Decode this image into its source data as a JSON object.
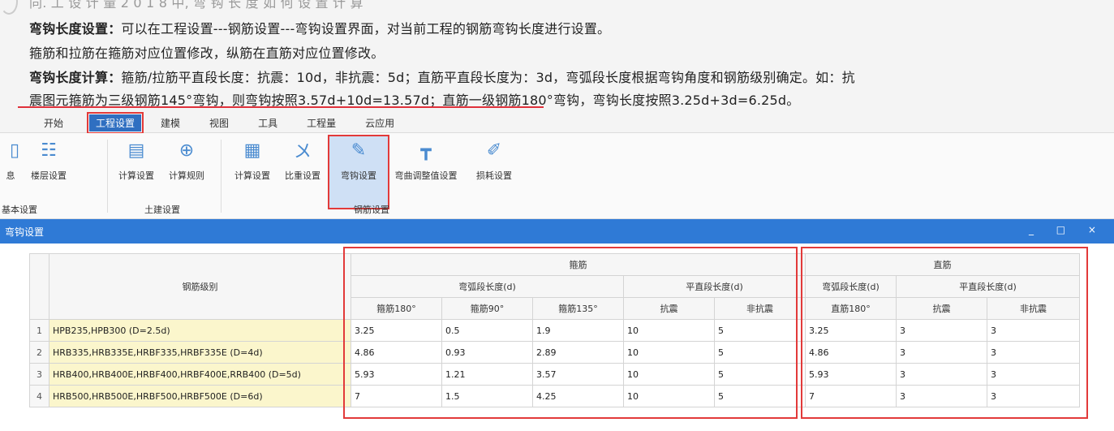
{
  "article": {
    "cut_line": "同. 工 设 计 量 2 0 1 8 中, 弯 钩 长 度 如 何 设 置 计 算",
    "p1_bold": "弯钩长度设置：",
    "p1_text": "可以在工程设置---钢筋设置---弯钩设置界面，对当前工程的钢筋弯钩长度进行设置。",
    "p2_text": "箍筋和拉筋在箍筋对应位置修改，纵筋在直筋对应位置修改。",
    "p3_bold": "弯钩长度计算：",
    "p3_text": "箍筋/拉筋平直段长度：抗震：10d，非抗震：5d；直筋平直段长度为：3d，弯弧段长度根据弯钩角度和钢筋级别确定。如：抗",
    "p4_text": "震图元箍筋为三级钢筋145°弯钩，则弯钩按照3.57d+10d=13.57d；直筋一级钢筋180°弯钩，弯钩长度按照3.25d+3d=6.25d。"
  },
  "menu": {
    "items": [
      "开始",
      "工程设置",
      "建模",
      "视图",
      "工具",
      "工程量",
      "云应用"
    ],
    "active": "工程设置"
  },
  "ribbon": {
    "buttons": [
      "息",
      "楼层设置",
      "计算设置",
      "计算规则",
      "计算设置",
      "比重设置",
      "弯钩设置",
      "弯曲调整值设置",
      "损耗设置"
    ],
    "groups": [
      "基本设置",
      "土建设置",
      "钢筋设置"
    ]
  },
  "dialog": {
    "title": "弯钩设置",
    "controls": "_ □ ×"
  },
  "table": {
    "header_level": "钢筋级别",
    "header_stirrup": "箍筋",
    "header_straight": "直筋",
    "sub_arc": "弯弧段长度(d)",
    "sub_flat": "平直段长度(d)",
    "sub_arc2": "弯弧段长度(d)",
    "sub_flat2": "平直段长度(d)",
    "cols": [
      "箍筋180°",
      "箍筋90°",
      "箍筋135°",
      "抗震",
      "非抗震",
      "直筋180°",
      "抗震",
      "非抗震"
    ],
    "rows": [
      {
        "n": "1",
        "level": "HPB235,HPB300 (D=2.5d)",
        "vals": [
          "3.25",
          "0.5",
          "1.9",
          "10",
          "5",
          "3.25",
          "3",
          "3"
        ]
      },
      {
        "n": "2",
        "level": "HRB335,HRB335E,HRBF335,HRBF335E (D=4d)",
        "vals": [
          "4.86",
          "0.93",
          "2.89",
          "10",
          "5",
          "4.86",
          "3",
          "3"
        ]
      },
      {
        "n": "3",
        "level": "HRB400,HRB400E,HRBF400,HRBF400E,RRB400 (D=5d)",
        "vals": [
          "5.93",
          "1.21",
          "3.57",
          "10",
          "5",
          "5.93",
          "3",
          "3"
        ]
      },
      {
        "n": "4",
        "level": "HRB500,HRB500E,HRBF500,HRBF500E (D=6d)",
        "vals": [
          "7",
          "1.5",
          "4.25",
          "10",
          "5",
          "7",
          "3",
          "3"
        ]
      }
    ]
  }
}
